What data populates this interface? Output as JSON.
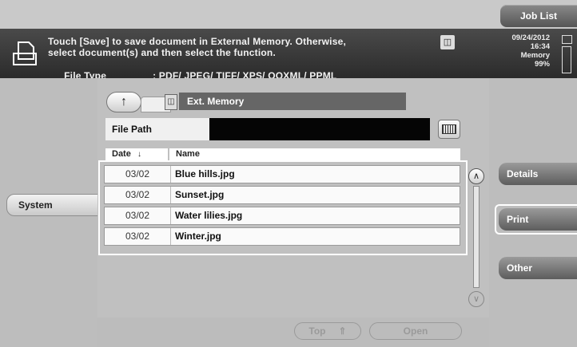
{
  "header": {
    "job_list_label": "Job List",
    "message_line1": "Touch [Save] to save document in External Memory. Otherwise,",
    "message_line2": "select document(s) and then select the function.",
    "file_type_label": "File Type",
    "file_type_value": ": PDF/ JPEG/ TIFF/ XPS/ OOXML/ PPML",
    "date": "09/24/2012",
    "time": "16:34",
    "memory_label": "Memory",
    "memory_value": "99%"
  },
  "left": {
    "system_label": "System"
  },
  "location": {
    "name": "Ext. Memory"
  },
  "file_path": {
    "label": "File Path",
    "value": ""
  },
  "table": {
    "col_date": "Date",
    "sort_indicator": "↓",
    "col_name": "Name",
    "rows": [
      {
        "date": "03/02",
        "name": "Blue hills.jpg"
      },
      {
        "date": "03/02",
        "name": "Sunset.jpg"
      },
      {
        "date": "03/02",
        "name": "Water lilies.jpg"
      },
      {
        "date": "03/02",
        "name": "Winter.jpg"
      }
    ]
  },
  "footer": {
    "top_label": "Top",
    "top_arrow": "⇑",
    "open_label": "Open"
  },
  "right": {
    "details_label": "Details",
    "print_label": "Print",
    "other_label": "Other"
  },
  "icons": {
    "document": "document-icon",
    "usb": "usb-memory-icon",
    "keyboard": "keyboard-icon"
  }
}
